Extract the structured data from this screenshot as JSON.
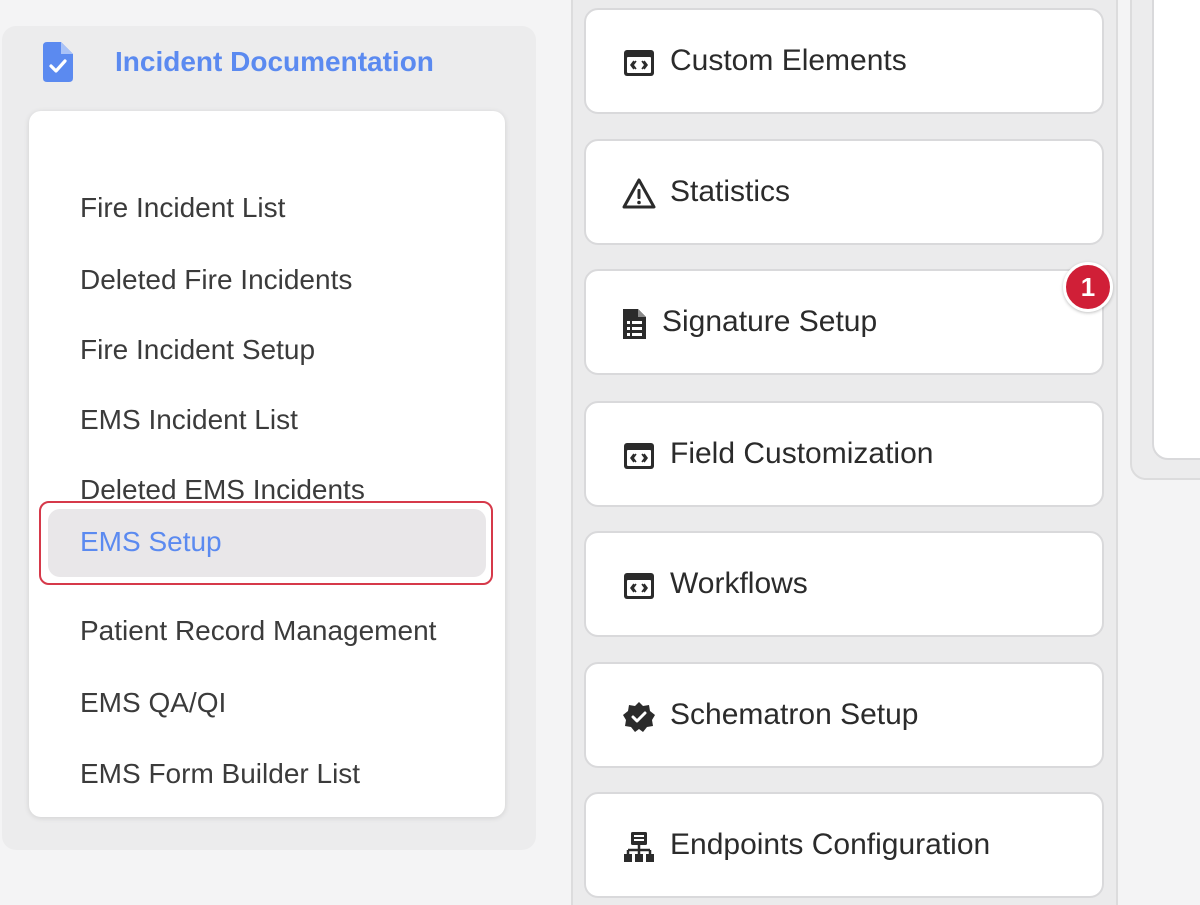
{
  "sidebar": {
    "title": "Incident Documentation",
    "items": [
      {
        "label": "Fire Incident List"
      },
      {
        "label": "Deleted Fire Incidents"
      },
      {
        "label": "Fire Incident Setup"
      },
      {
        "label": "EMS Incident List"
      },
      {
        "label": "Deleted EMS Incidents"
      },
      {
        "label": "EMS Setup",
        "active": true
      },
      {
        "label": "Patient Record Management"
      },
      {
        "label": "EMS QA/QI"
      },
      {
        "label": "EMS Form Builder List"
      }
    ]
  },
  "settings": {
    "cards": [
      {
        "label": "Custom Elements",
        "icon": "code-window-icon"
      },
      {
        "label": "Statistics",
        "icon": "warning-triangle-icon"
      },
      {
        "label": "Signature Setup",
        "icon": "document-list-icon"
      },
      {
        "label": "Field Customization",
        "icon": "code-window-icon"
      },
      {
        "label": "Workflows",
        "icon": "code-window-icon"
      },
      {
        "label": "Schematron Setup",
        "icon": "verified-badge-icon"
      },
      {
        "label": "Endpoints Configuration",
        "icon": "network-icon"
      }
    ],
    "step_badge": "1"
  },
  "colors": {
    "accent": "#5b8af0",
    "highlight_border": "#d6394a",
    "badge": "#d01f37"
  }
}
